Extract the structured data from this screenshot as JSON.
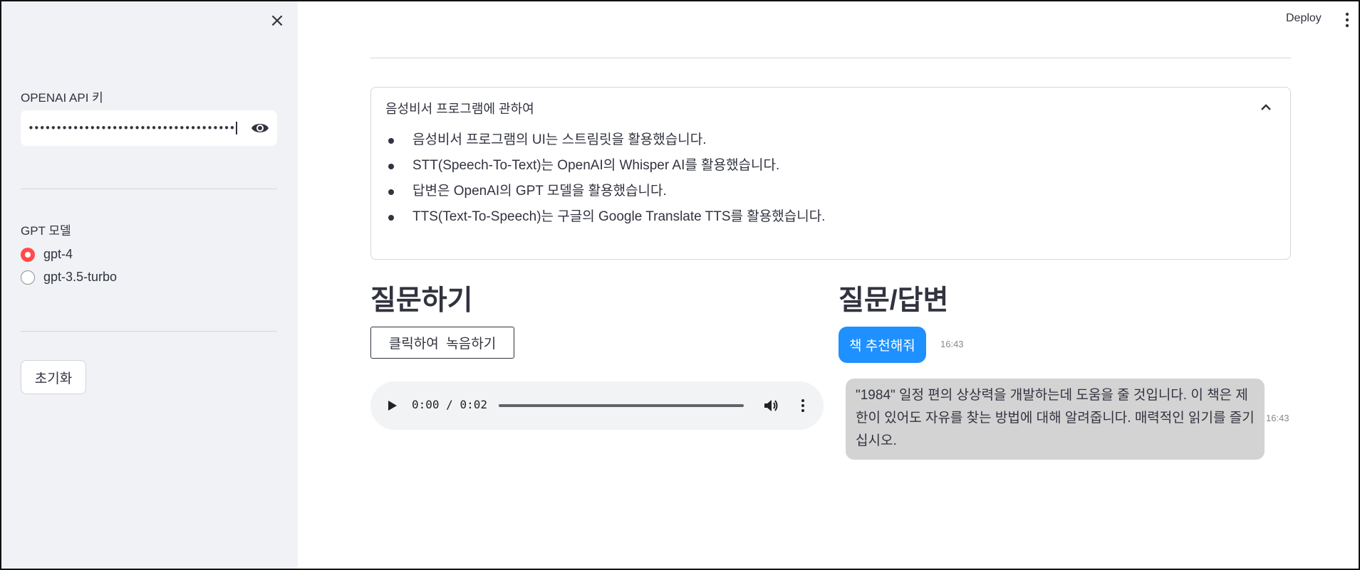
{
  "header": {
    "deploy_label": "Deploy",
    "menu_icon": "vertical-dots-icon"
  },
  "sidebar": {
    "close_icon": "×",
    "api_key_label": "OPENAI API 키",
    "api_key_value": "••••••••••••••••••••••••••••••••••••••••••••••••••",
    "model_label": "GPT 모델",
    "models": [
      {
        "label": "gpt-4",
        "selected": true
      },
      {
        "label": "gpt-3.5-turbo",
        "selected": false
      }
    ],
    "reset_label": "초기화",
    "accent_color": "#ff4b4b"
  },
  "expander": {
    "title": "음성비서 프로그램에 관하여",
    "items": [
      "음성비서 프로그램의 UI는 스트림릿을 활용했습니다.",
      "STT(Speech-To-Text)는 OpenAI의 Whisper AI를 활용했습니다.",
      "답변은 OpenAI의 GPT 모델을 활용했습니다.",
      "TTS(Text-To-Speech)는 구글의 Google Translate TTS를 활용했습니다."
    ]
  },
  "ask": {
    "title": "질문하기",
    "record_label": "클릭하여  녹음하기",
    "audio": {
      "current": "0:00",
      "separator": "/",
      "duration": "0:02",
      "progress_fraction": 0
    }
  },
  "chat": {
    "title": "질문/답변",
    "messages": [
      {
        "role": "user",
        "text": "책 추천해줘",
        "time": "16:43",
        "color": "#1e90ff"
      },
      {
        "role": "assistant",
        "text": "\"1984\" 일정 편의 상상력을 개발하는데 도움을 줄 것입니다. 이 책은 제한이 있어도 자유를 찾는 방법에 대해 알려줍니다. 매력적인 읽기를 즐기십시오.",
        "time": "16:43",
        "color": "#d3d3d3"
      }
    ]
  }
}
